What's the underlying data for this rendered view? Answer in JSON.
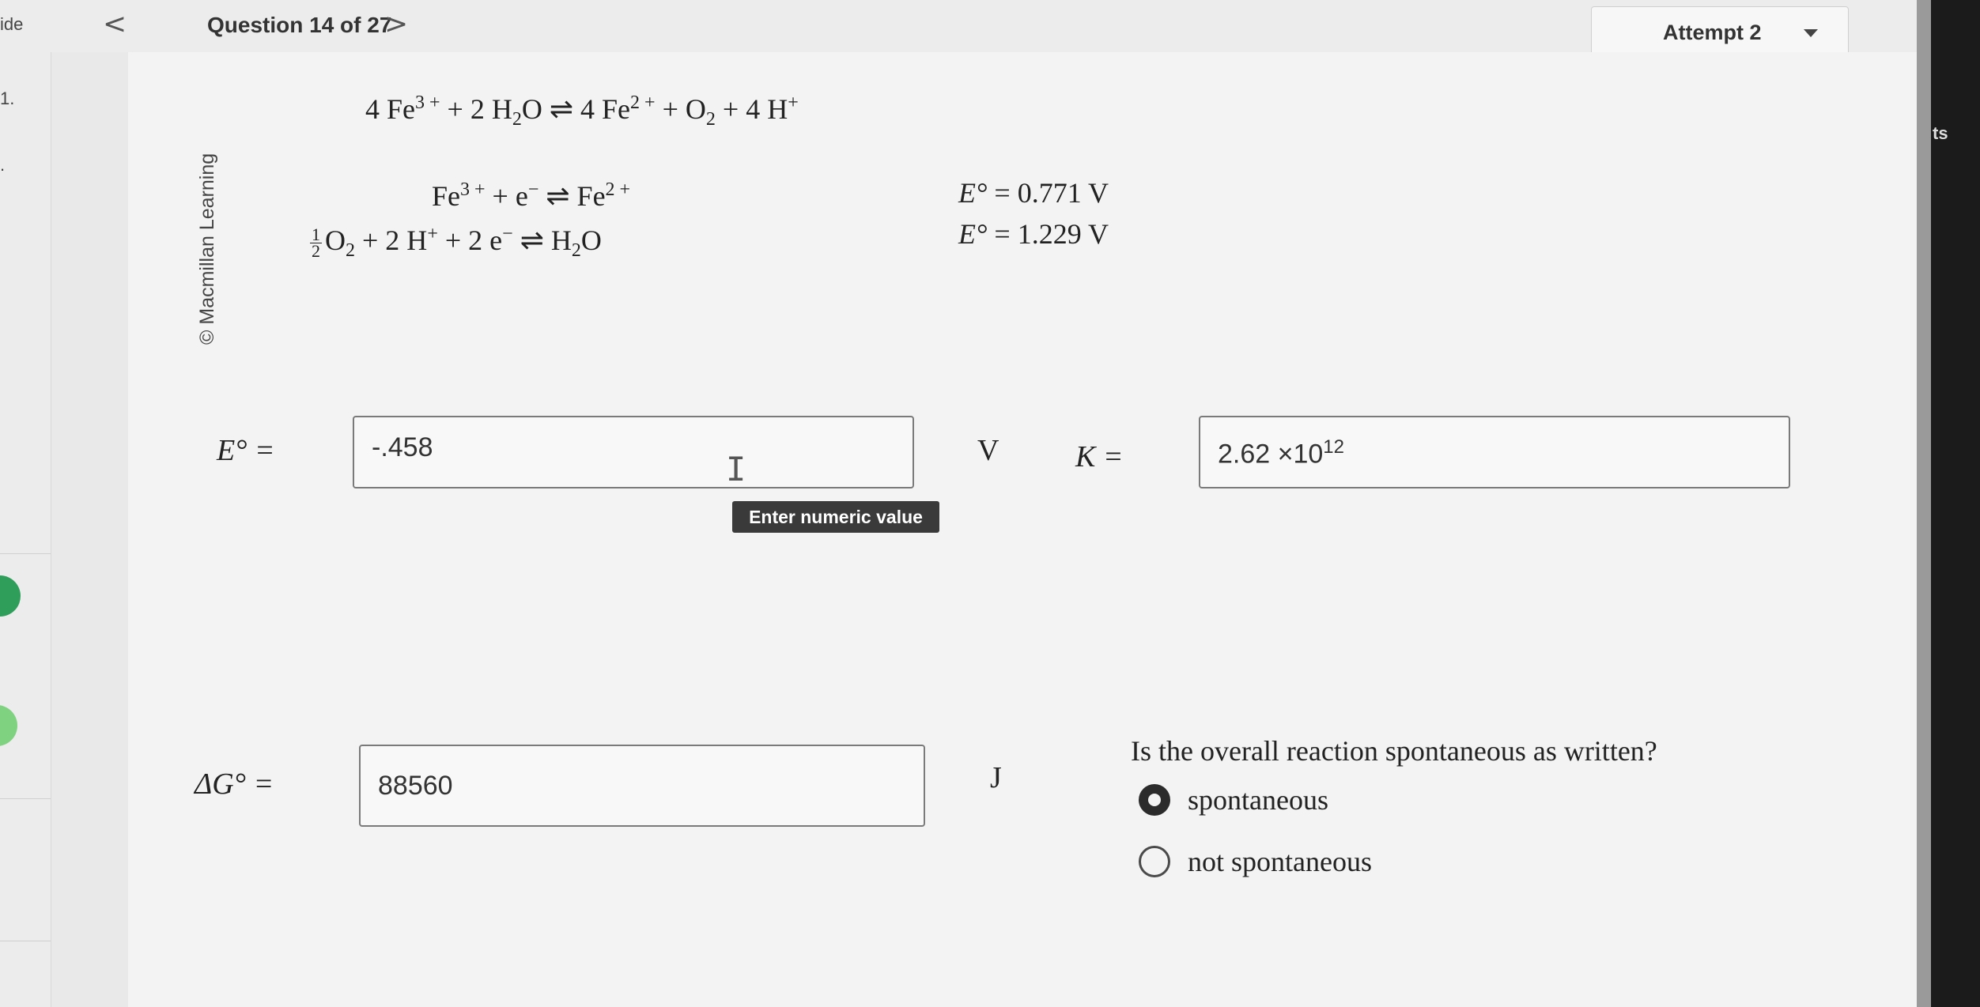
{
  "left_panel": {
    "text_top": "ide",
    "text_mid": "1.",
    "text_dot": "."
  },
  "nav": {
    "prev": "<",
    "title": "Question 14 of 27",
    "next": ">"
  },
  "attempt": {
    "label": "Attempt 2"
  },
  "right_panel": {
    "text": "ts"
  },
  "credit": "© Macmillan Learning",
  "reaction": {
    "overall": {
      "lhs_a": "4 Fe",
      "lhs_a_sup": "3 +",
      "lhs_b": " + 2 H",
      "lhs_b_sub": "2",
      "lhs_c": "O",
      "arrow": " ⇌ ",
      "rhs_a": "4 Fe",
      "rhs_a_sup": "2 +",
      "rhs_b": " + O",
      "rhs_b_sub": "2",
      "rhs_c": " + 4 H",
      "rhs_c_sup": "+"
    },
    "half1": {
      "a": "Fe",
      "a_sup": "3 +",
      "b": " + e",
      "b_sup": "−",
      "arrow": " ⇌ ",
      "c": "Fe",
      "c_sup": "2 +",
      "e_label": "E°",
      "e_value": " = 0.771 V"
    },
    "half2": {
      "frac_num": "1",
      "frac_den": "2",
      "a": "O",
      "a_sub": "2",
      "b": " + 2 H",
      "b_sup": "+",
      "c": " + 2 e",
      "c_sup": "−",
      "arrow": " ⇌ ",
      "d": "H",
      "d_sub": "2",
      "e": "O",
      "e_label": "E°",
      "e_value": " = 1.229 V"
    }
  },
  "fields": {
    "e_label": "E° =",
    "e_value": "-.458",
    "e_unit": "V",
    "k_label": "K =",
    "k_value": "2.62 ×10",
    "k_exp": "12",
    "g_label": "ΔG° =",
    "g_value": "88560",
    "g_unit": "J"
  },
  "tooltip": "Enter numeric value",
  "question": {
    "prompt": "Is the overall reaction spontaneous as written?",
    "options": [
      {
        "label": "spontaneous",
        "selected": true
      },
      {
        "label": "not spontaneous",
        "selected": false
      }
    ]
  }
}
